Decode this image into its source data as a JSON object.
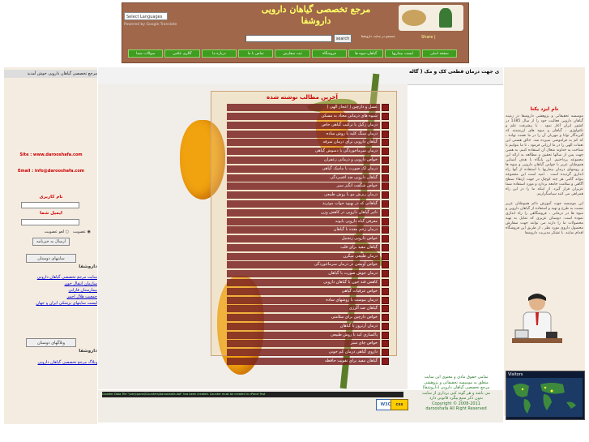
{
  "header": {
    "language_select": "Select Languages",
    "language_powered": "Powered by Google Translate",
    "title_line1": "مرجع تخصصی گیاهان دارویی",
    "title_line2": "داروشفا",
    "logo_text": "Share |",
    "search_button": "search",
    "search_hint": "جستجو در سایت داروشفا"
  },
  "nav": {
    "items": [
      "صفحه اصلی",
      "لیست بیماریها",
      "گیاهان-میوه ها",
      "فروشگاه",
      "ثبت سفارش",
      "تماس با ما",
      "درباره ما",
      "گالری عکس",
      "سوالات شما"
    ]
  },
  "left": {
    "heading": "مرجع تخصصی گیاهان دارویی خوش آمدید",
    "site_line": "Site : www.darooshafa.com",
    "email_line": "Email : info@darooshafa.com",
    "username_label": "نام کاربری",
    "password_label": "ایمیل شما",
    "radio_subscribe": "عضویت",
    "radio_unsubscribe": "لغو عضویت",
    "submit_button": "ارسال به خبرنامه",
    "block1_button": "سایتهای دوستان",
    "block1_title": "داروشفا",
    "block1_links": [
      "سایت مرجع تخصصی گیاهان دارویی",
      "سازمان انتقال خون",
      "بیمارستان فارابی",
      "جمعیت هلال احمر",
      "لیست سایتهای پزشکی ایران و جهان"
    ],
    "block2_button": "وبلاگهای دوستان",
    "block2_title": "داروشفا",
    "block2_links": [
      "وبلاگ مرجع تخصصی گیاهان دارویی"
    ]
  },
  "center": {
    "scroll_text": "ی جهت درمان قطعی کک و مک ( گاله",
    "news_title": "آخرین مطالب نوشته شده",
    "news_items": [
      "عسل و دارچین ( اعجاز الهی )",
      "شیوه های درمانی معتاد به مسکن",
      "درمان زگیل با ترکیب گیاهی خاص",
      "درمان سنگ کلیه با روش ساده",
      "گیاهان دارویی برای درمان سرفه",
      "درمان سرماخوردگی با دمنوش گیاهی",
      "خواص دارویی و درمانی زعفران",
      "درمان لک صورت با ماسک گیاهی",
      "گیاهان دارویی ضد افسردگی",
      "خواص شگفت انگیز سیر",
      "درمان ریزش مو با روش طبیعی",
      "گیاهانی که در بهبود خواب موثرند",
      "تاثیر گیاهان دارویی در کاهش وزن",
      "معرفی گیاه دارویی بابونه",
      "درمان زخم معده با گیاهان",
      "خواص دارویی زنجبیل",
      "گیاهان مفید برای قلب",
      "درمان طبیعی میگرن",
      "خواص آویشن در درمان سرماخوردگی",
      "درمان جوش صورت با گیاهان",
      "کاهش قند خون با گیاهان دارویی",
      "خواص عرقیات گیاهی",
      "درمان یبوست با روشهای ساده",
      "گیاهان ضد آلرژی",
      "خواص دارچین برای سلامتی",
      "درمان آرتروز با گیاهان",
      "پاکسازی کبد با روش طبیعی",
      "خواص چای سبز",
      "داروی گیاهی درمان کم خونی",
      "گیاهان مفید برای تقویت حافظه"
    ]
  },
  "right": {
    "title": "نام ایزد یکتا",
    "body": "موسسه تحقیقاتی و پژوهشی داروشفا در زمینه گیاهان دارویی فعالیت خود را از سال 1385 در کشور ایران آغاز نمود . با پیشرفت علم و تکنولوژی ، گیاهان و میوه های ارزشمند که آفریدگار توانا و مهربان آن را در ما نعمت نهاده ، که کم به فراموشی سپرده شد. خالق هستی این نعمات الهی را در ما ارزانی فرمود ، تا ما بتوانیم با شناخت به خداوند متعال آن استفاده کنیم. به همین جهت پس از سالها تحقیق و مطالعه به ارائه این مجموعه پرداختیم. این پایگاه با هدف آشنایی هموطنان عزیز با خواص گیاهان دارویی و میوه ها و روشهای درمان بیماریها با استفاده از آنها راه اندازی گردیده است . امید است این مجموعه بتواند گامی هر چند کوچک در جهت ارتقاء سطح آگاهی و سلامت جامعه بردارد و مورد استفاده شما عزیزان قرار گیرد. از اینکه ما را در این راه همراهی می کنید سپاسگزاریم.",
    "body2": "این موسسه جهت آموزش دائم هموطنان عزیز نسبت به طرح و تهیه و استفاده از گیاهان دارویی و میوه ها در درمانی ، فروشگاهی را راه اندازی نموده است. دوستان عزیزی که تمایل به تهیه محصولات ما را دارند می توانند جهت سفارش محصول داروی مورد نظر ، از طریق این فروشگاه اقدام نمایند. با تشکر مدیریت داروشفا",
    "visitors_label": "Visitors"
  },
  "footer": {
    "counter": "Counter Data File \"/var/cpanel/Counters/darooshafa.dat\" has been created. Counter must be created in cPanel first",
    "copyright_lines": [
      "تمامی حقوق مادی و معنوی این سایت",
      "متعلق به موسسه تحقیقاتی و پژوهشی",
      "مرجع تخصصی گیاهان دارویی (داروشفا)",
      "می باشد و هر گونه کپی برداری از سایت",
      "بدون ذکر منبع پیگرد قانونی دارد",
      "Copyright © 2008-2011",
      "darooshafa All Right Reserved"
    ],
    "w3c_badge": "W3C",
    "css_badge": "css"
  },
  "colors": {
    "header_bg": "#a0674a",
    "nav_green": "#3f9d1f",
    "news_row": "#782020",
    "title_yellow": "#ffff66"
  }
}
